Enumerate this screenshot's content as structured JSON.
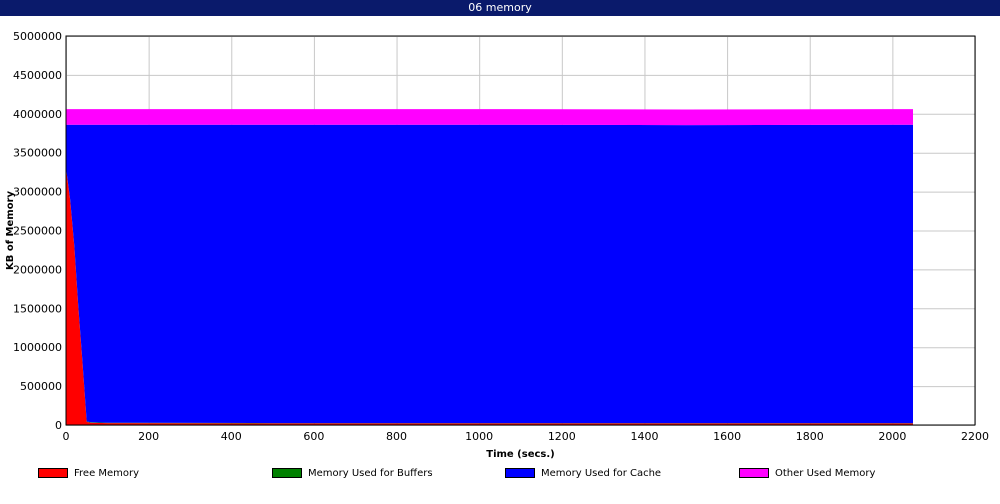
{
  "window": {
    "title": "06 memory"
  },
  "chart_data": {
    "type": "area",
    "stacked": true,
    "xlabel": "Time (secs.)",
    "ylabel": "KB of Memory",
    "xlim": [
      0,
      2200
    ],
    "ylim": [
      0,
      5000000
    ],
    "xticks": [
      0,
      200,
      400,
      600,
      800,
      1000,
      1200,
      1400,
      1600,
      1800,
      2000,
      2200
    ],
    "yticks": [
      0,
      500000,
      1000000,
      1500000,
      2000000,
      2500000,
      3000000,
      3500000,
      4000000,
      4500000,
      5000000
    ],
    "grid": true,
    "legend_position": "bottom",
    "x": [
      0,
      10,
      20,
      30,
      40,
      50,
      60,
      100,
      500,
      1000,
      1500,
      2000,
      2050
    ],
    "series": [
      {
        "name": "Free Memory",
        "color": "#ff0000",
        "values": [
          3300000,
          2900000,
          2300000,
          1500000,
          800000,
          40000,
          30000,
          25000,
          20000,
          20000,
          20000,
          20000,
          20000
        ]
      },
      {
        "name": "Memory Used for Buffers",
        "color": "#008000",
        "values": [
          5000,
          5000,
          5000,
          5000,
          5000,
          5000,
          5000,
          5000,
          5000,
          5000,
          5000,
          5000,
          5000
        ]
      },
      {
        "name": "Memory Used for Cache",
        "color": "#0000ff",
        "values": [
          555000,
          955000,
          1555000,
          2355000,
          3055000,
          3815000,
          3825000,
          3830000,
          3835000,
          3835000,
          3830000,
          3835000,
          3835000
        ]
      },
      {
        "name": "Other Used Memory",
        "color": "#ff00ff",
        "values": [
          200000,
          200000,
          200000,
          200000,
          200000,
          200000,
          200000,
          200000,
          200000,
          200000,
          200000,
          200000,
          200000
        ]
      }
    ]
  }
}
